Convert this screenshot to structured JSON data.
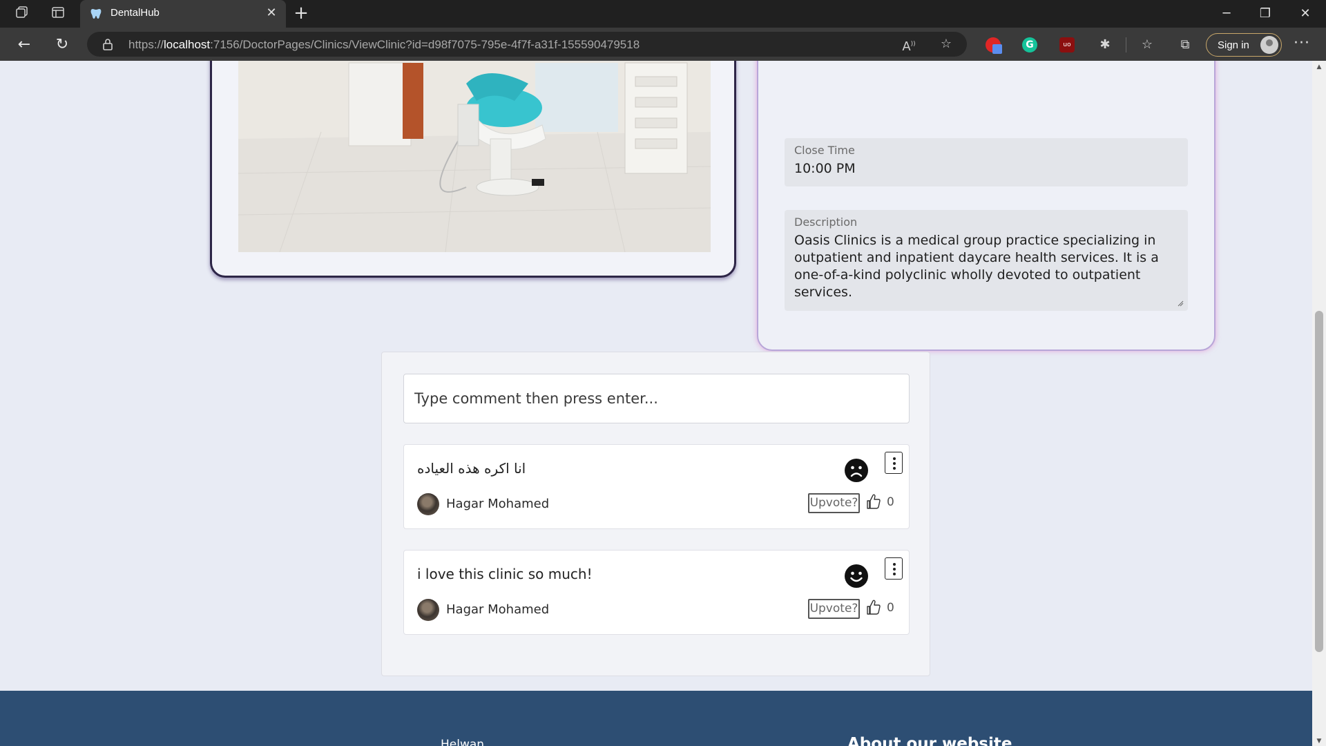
{
  "browser": {
    "tab_title": "DentalHub",
    "url_scheme": "https://",
    "url_host": "localhost",
    "url_rest": ":7156/DoctorPages/Clinics/ViewClinic?id=d98f7075-795e-4f7f-a31f-155590479518",
    "signin_label": "Sign in"
  },
  "clinic": {
    "close_time_label": "Close Time",
    "close_time_value": "10:00 PM",
    "description_label": "Description",
    "description_value": "Oasis Clinics is a medical group practice specializing in outpatient and inpatient daycare health services. It is a one-of-a-kind polyclinic wholly devoted to outpatient services."
  },
  "comments": {
    "input_placeholder": "Type comment then press enter...",
    "items": [
      {
        "text": "انا اكره هذه العياده",
        "author": "Hagar Mohamed",
        "mood": "sad-face-icon",
        "upvote_label": "Upvote?",
        "votes": "0"
      },
      {
        "text": "i love this clinic so much!",
        "author": "Hagar Mohamed",
        "mood": "happy-face-icon",
        "upvote_label": "Upvote?",
        "votes": "0"
      }
    ]
  },
  "footer": {
    "city": "Helwan",
    "about_heading": "About our website"
  },
  "colors": {
    "page_bg": "#e8ebf4",
    "footer_bg": "#2d4e73",
    "image_card_border": "#2d2547",
    "info_card_glow": "#de6ec8"
  }
}
